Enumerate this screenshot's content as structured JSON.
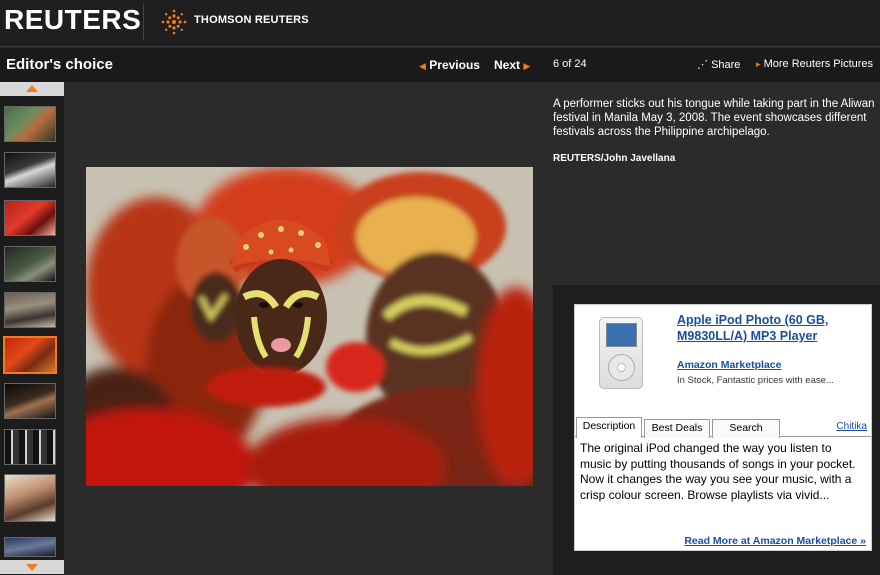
{
  "header": {
    "brand": "REUTERS",
    "partner": "THOMSON REUTERS"
  },
  "toolbar": {
    "section_title": "Editor's choice",
    "prev_label": "Previous",
    "next_label": "Next",
    "counter": "6 of 24",
    "share_label": "Share",
    "more_label": "More Reuters Pictures"
  },
  "thumbnails": {
    "count": 11,
    "active_index": 6
  },
  "photo": {
    "caption": "A performer sticks out his tongue while taking part in the Aliwan festival in Manila May 3, 2008. The event showcases different festivals across the Philippine archipelago.",
    "credit": "REUTERS/John Javellana"
  },
  "ad": {
    "title": "Apple iPod Photo (60 GB, M9830LL/A) MP3 Player",
    "seller": "Amazon Marketplace",
    "stock": "In Stock, Fantastic prices with ease...",
    "tabs": [
      "Description",
      "Best Deals",
      "Search"
    ],
    "provider": "Chitika",
    "description": "The original iPod changed the way you listen to music by putting thousands of songs in your pocket. Now it changes the way you see your music, with a crisp colour screen. Browse playlists via vivid...",
    "read_more": "Read More at Amazon Marketplace »"
  },
  "colors": {
    "accent": "#f07c1b",
    "link": "#1a4f9c",
    "background": "#2b2b2b"
  }
}
